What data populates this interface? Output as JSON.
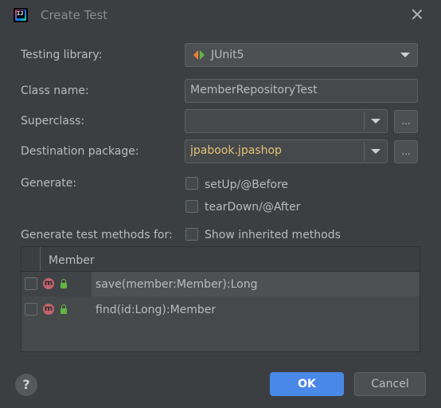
{
  "dialog": {
    "title": "Create Test"
  },
  "form": {
    "testing_library_label": "Testing library:",
    "testing_library_value": "JUnit5",
    "class_name_label": "Class name:",
    "class_name_value": "MemberRepositoryTest",
    "superclass_label": "Superclass:",
    "superclass_value": "",
    "destination_label": "Destination package:",
    "destination_value": "jpabook.jpashop",
    "browse_label": "...",
    "generate_label": "Generate:",
    "setup_label": "setUp/@Before",
    "setup_checked": false,
    "teardown_label": "tearDown/@After",
    "teardown_checked": false,
    "methods_for_label": "Generate test methods for:",
    "show_inherited_label": "Show inherited methods",
    "show_inherited_checked": false
  },
  "table": {
    "header": "Member",
    "rows": [
      {
        "badge": "m",
        "signature": "save(member:Member):Long",
        "checked": false,
        "selected": true
      },
      {
        "badge": "m",
        "signature": "find(id:Long):Member",
        "checked": false,
        "selected": false
      }
    ]
  },
  "footer": {
    "help_label": "?",
    "ok_label": "OK",
    "cancel_label": "Cancel"
  },
  "colors": {
    "background": "#3c3f41",
    "accent": "#4a88e8",
    "package_text": "#e5c07b"
  }
}
